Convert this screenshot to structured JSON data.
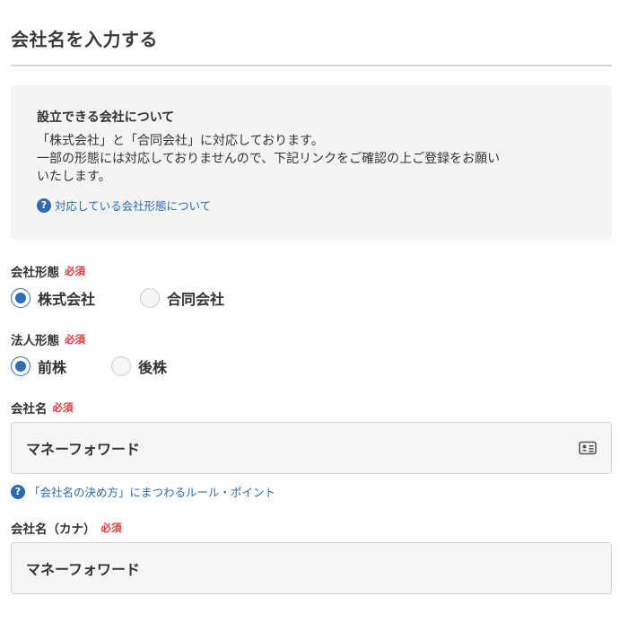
{
  "page": {
    "title": "会社名を入力する"
  },
  "info": {
    "heading": "設立できる会社について",
    "lines": [
      "「株式会社」と「合同会社」に対応しております。",
      "一部の形態には対応しておりませんので、下記リンクをご確認の上ご登録をお願い",
      "いたします。"
    ],
    "link_label": "対応している会社形態について",
    "link_icon": "question-circle-icon"
  },
  "company_type": {
    "label": "会社形態",
    "required": "必須",
    "options": [
      "株式会社",
      "合同会社"
    ],
    "selected": "株式会社"
  },
  "corporate_form": {
    "label": "法人形態",
    "required": "必須",
    "options": [
      "前株",
      "後株"
    ],
    "selected": "前株"
  },
  "company_name": {
    "label": "会社名",
    "required": "必須",
    "value": "マネーフォワード",
    "trailing_icon": "contact-card-icon",
    "help_link": "「会社名の決め方」にまつわるルール・ポイント",
    "help_icon": "question-circle-icon"
  },
  "company_name_kana": {
    "label": "会社名（カナ）",
    "required": "必須",
    "value": "マネーフォワード"
  },
  "colors": {
    "accent": "#2f6db7",
    "link": "#2b6cb0",
    "required": "#e03c3c"
  }
}
